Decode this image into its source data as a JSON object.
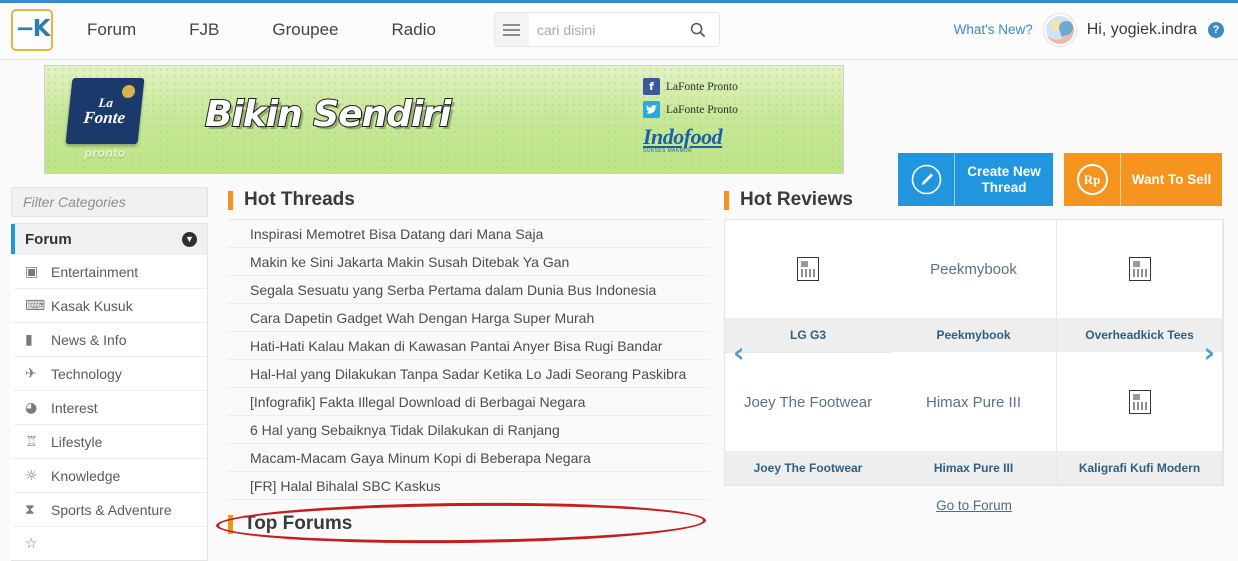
{
  "header": {
    "logo_alt": "Kaskus",
    "nav": [
      {
        "label": "Forum"
      },
      {
        "label": "FJB"
      },
      {
        "label": "Groupee"
      },
      {
        "label": "Radio"
      }
    ],
    "search": {
      "placeholder": "cari disini",
      "value": ""
    },
    "whats_new": "What's New?",
    "greeting": "Hi, yogiek.indra",
    "help_label": "?"
  },
  "banner": {
    "brand_line1": "La",
    "brand_line2": "Fonte",
    "brand_sub": "pronto",
    "headline": "Bikin Sendiri",
    "social": [
      {
        "network": "facebook",
        "icon_glyph": "f",
        "handle": "LaFonte Pronto"
      },
      {
        "network": "twitter",
        "icon_glyph": "t",
        "handle": "LaFonte Pronto"
      }
    ],
    "sponsor": "Indofood",
    "sponsor_sub": "SUKSES MAKMUR"
  },
  "cta": {
    "create_thread": "Create New Thread",
    "want_to_sell": "Want To Sell",
    "rp_symbol": "Rp"
  },
  "sidebar": {
    "filter_placeholder": "Filter Categories",
    "filter_value": "",
    "panel_title": "Forum",
    "items": [
      {
        "label": "Entertainment",
        "icon": "tv-icon",
        "glyph": "▣"
      },
      {
        "label": "Kasak Kusuk",
        "icon": "chat-icon",
        "glyph": "⌨"
      },
      {
        "label": "News & Info",
        "icon": "briefcase-icon",
        "glyph": "▮"
      },
      {
        "label": "Technology",
        "icon": "rocket-icon",
        "glyph": "✈"
      },
      {
        "label": "Interest",
        "icon": "palette-icon",
        "glyph": "◕"
      },
      {
        "label": "Lifestyle",
        "icon": "hat-icon",
        "glyph": "♖"
      },
      {
        "label": "Knowledge",
        "icon": "bulb-icon",
        "glyph": "☼"
      },
      {
        "label": "Sports & Adventure",
        "icon": "stopwatch-icon",
        "glyph": "⧗"
      }
    ]
  },
  "hot_threads": {
    "title": "Hot Threads",
    "items": [
      {
        "title": "Inspirasi Memotret Bisa Datang dari Mana Saja"
      },
      {
        "title": "Makin ke Sini Jakarta Makin Susah Ditebak Ya Gan"
      },
      {
        "title": "Segala Sesuatu yang Serba Pertama dalam Dunia Bus Indonesia"
      },
      {
        "title": "Cara Dapetin Gadget Wah Dengan Harga Super Murah"
      },
      {
        "title": "Hati-Hati Kalau Makan di Kawasan Pantai Anyer Bisa Rugi Bandar"
      },
      {
        "title": "Hal-Hal yang Dilakukan Tanpa Sadar Ketika Lo Jadi Seorang Paskibra"
      },
      {
        "title": "[Infografik] Fakta Illegal Download di Berbagai Negara"
      },
      {
        "title": "6 Hal yang Sebaiknya Tidak Dilakukan di Ranjang"
      },
      {
        "title": "Macam-Macam Gaya Minum Kopi di Beberapa Negara"
      },
      {
        "title": "[FR] Halal Bihalal SBC Kaskus"
      }
    ],
    "highlight_index": 4,
    "highlight_color": "#c41e1e"
  },
  "top_forums": {
    "title": "Top Forums"
  },
  "hot_reviews": {
    "title": "Hot Reviews",
    "prev_arrow": "‹",
    "next_arrow": "›",
    "items": [
      {
        "thumb_text": "",
        "thumb_broken": true,
        "caption": "LG G3"
      },
      {
        "thumb_text": "Peekmybook",
        "thumb_broken": false,
        "caption": "Peekmybook"
      },
      {
        "thumb_text": "",
        "thumb_broken": true,
        "caption": "Overheadkick Tees"
      },
      {
        "thumb_text": "Joey The Footwear",
        "thumb_broken": false,
        "caption": "Joey The Footwear"
      },
      {
        "thumb_text": "Himax Pure III",
        "thumb_broken": false,
        "caption": "Himax Pure III"
      },
      {
        "thumb_text": "",
        "thumb_broken": true,
        "caption": "Kaligrafi Kufi Modern"
      }
    ],
    "go_to_forum": "Go to Forum"
  },
  "theme": {
    "accent_blue": "#2196de",
    "accent_orange": "#f5941e",
    "section_marker": "#f0941f",
    "link_blue": "#3b8ac4",
    "annotation_red": "#c41e1e"
  }
}
